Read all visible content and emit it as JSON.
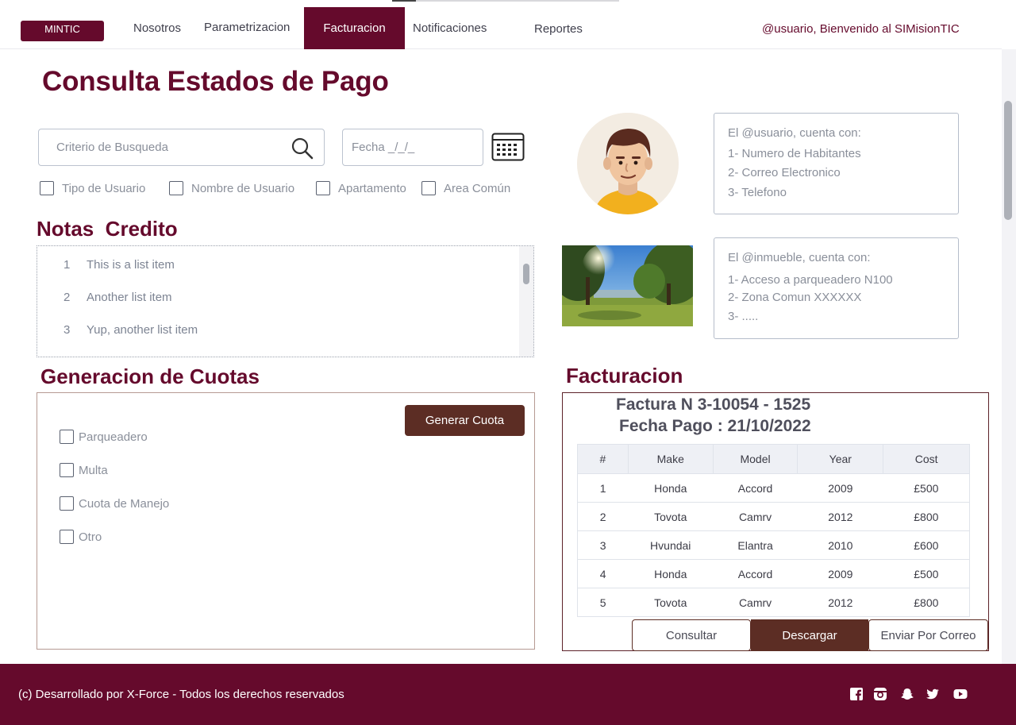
{
  "nav": {
    "brand": "MINTIC",
    "links": [
      "Nosotros",
      "Parametrizacion",
      "Facturacion",
      "Notificaciones",
      "Reportes"
    ],
    "active": "Facturacion",
    "welcome": "@usuario, Bienvenido al SIMisionTIC"
  },
  "page": {
    "title": "Consulta Estados de Pago"
  },
  "search": {
    "placeholder": "Criterio de Busqueda",
    "date_placeholder": "Fecha _/_/_",
    "filters": [
      "Tipo de Usuario",
      "Nombre de Usuario",
      "Apartamento",
      "Area Común"
    ]
  },
  "notas": {
    "title": "Notas  Credito",
    "items": [
      {
        "num": "1",
        "text": "This is a list item"
      },
      {
        "num": "2",
        "text": "Another list item"
      },
      {
        "num": "3",
        "text": "Yup, another list item"
      }
    ]
  },
  "cuotas": {
    "title": "Generacion de Cuotas",
    "button": "Generar Cuota",
    "options": [
      "Parqueadero",
      "Multa",
      "Cuota de Manejo",
      "Otro"
    ]
  },
  "usuario_info": {
    "lines": [
      "El  @usuario, cuenta con:",
      "1- Numero de Habitantes",
      "2- Correo Electronico",
      "3- Telefono"
    ]
  },
  "inmueble_info": {
    "lines": [
      "El  @inmueble, cuenta con:",
      "1- Acceso a parqueadero N100",
      "2- Zona Comun XXXXXX",
      "3- ....."
    ]
  },
  "facturacion": {
    "title": "Facturacion",
    "factura": "Factura N 3-10054 - 1525",
    "fecha": "Fecha Pago : 21/10/2022",
    "columns": [
      "#",
      "Make",
      "Model",
      "Year",
      "Cost"
    ],
    "rows": [
      [
        "1",
        "Honda",
        "Accord",
        "2009",
        "£500"
      ],
      [
        "2",
        "Tovota",
        "Camrv",
        "2012",
        "£800"
      ],
      [
        "3",
        "Hvundai",
        "Elantra",
        "2010",
        "£600"
      ],
      [
        "4",
        "Honda",
        "Accord",
        "2009",
        "£500"
      ],
      [
        "5",
        "Tovota",
        "Camrv",
        "2012",
        "£800"
      ]
    ],
    "buttons": {
      "consultar": "Consultar",
      "descargar": "Descargar",
      "enviar": "Enviar Por Correo"
    }
  },
  "footer": {
    "text": "(c)  Desarrollado por X-Force - Todos los derechos reservados",
    "social": [
      "facebook-icon",
      "instagram-icon",
      "snapchat-icon",
      "twitter-icon",
      "youtube-icon"
    ]
  },
  "colors": {
    "primary": "#650a2c",
    "button_brown": "#5c2d24"
  }
}
